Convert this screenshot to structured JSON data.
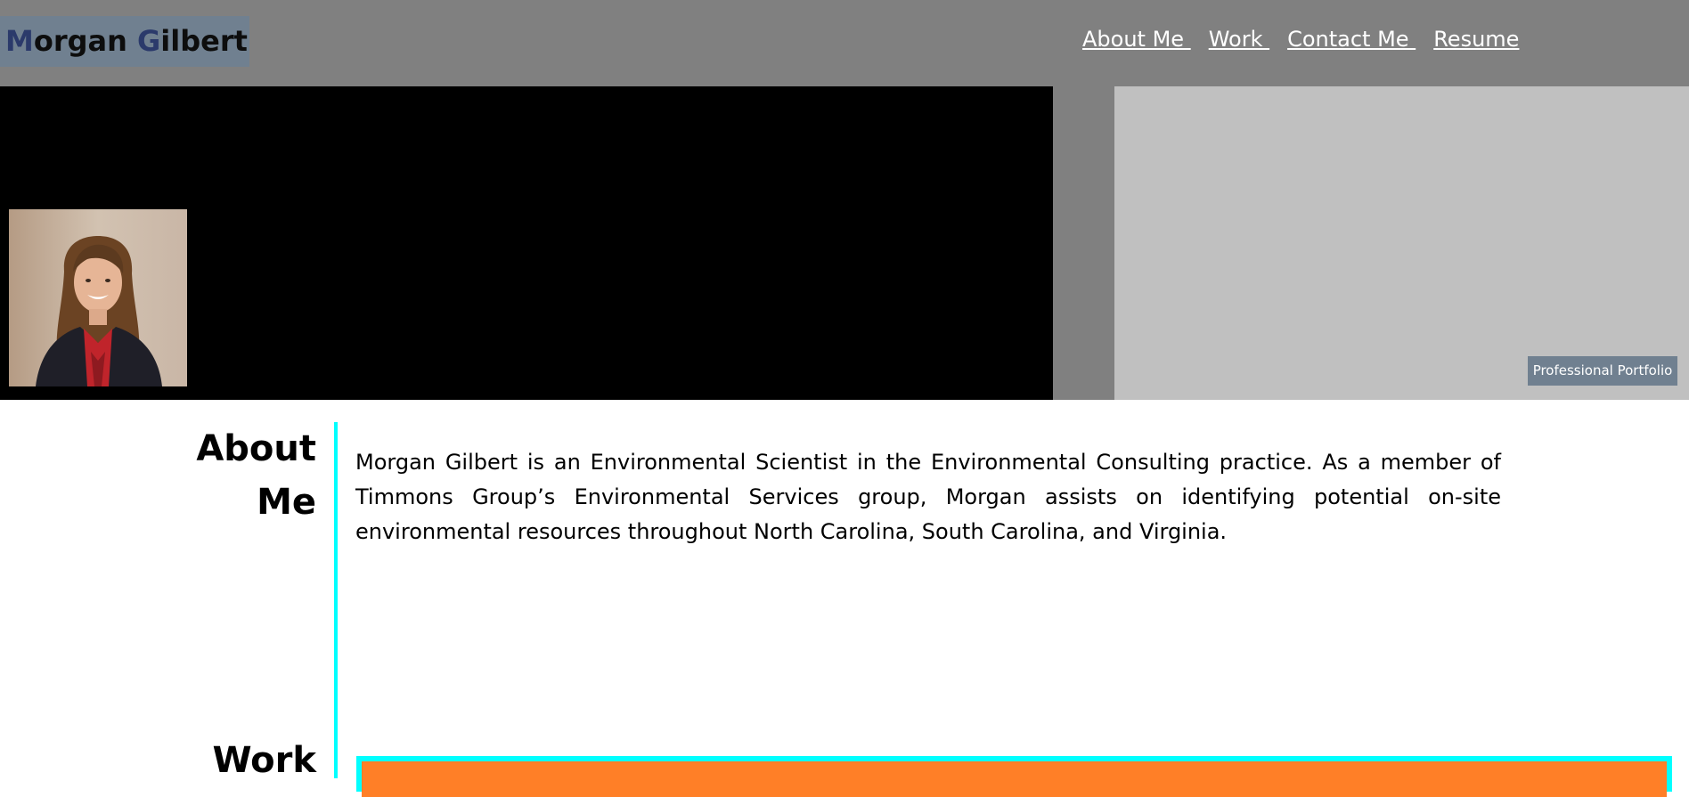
{
  "header": {
    "logo": {
      "first_initial": "M",
      "first_rest": "organ ",
      "last_initial": "G",
      "last_rest": "ilbert"
    },
    "nav": [
      {
        "label": "About Me "
      },
      {
        "label": "Work "
      },
      {
        "label": "Contact Me "
      },
      {
        "label": "Resume"
      }
    ]
  },
  "hero": {
    "badge": "Professional Portfolio"
  },
  "about": {
    "title_line1": "About",
    "title_line2": "Me",
    "text": "Morgan Gilbert is an Environmental Scientist in the Environmental Consulting practice. As a member of Timmons Group’s Environmental Services group, Morgan assists on identifying potential on-site environmental resources throughout North Carolina, South Carolina, and Virginia."
  },
  "work": {
    "title": "Work"
  },
  "colors": {
    "header_bg": "#808080",
    "logo_bg": "#708090",
    "accent_cyan": "#00ffff",
    "work_card": "#ff7f27",
    "hero_black": "#000000",
    "hero_gray": "#c0c0c0"
  }
}
